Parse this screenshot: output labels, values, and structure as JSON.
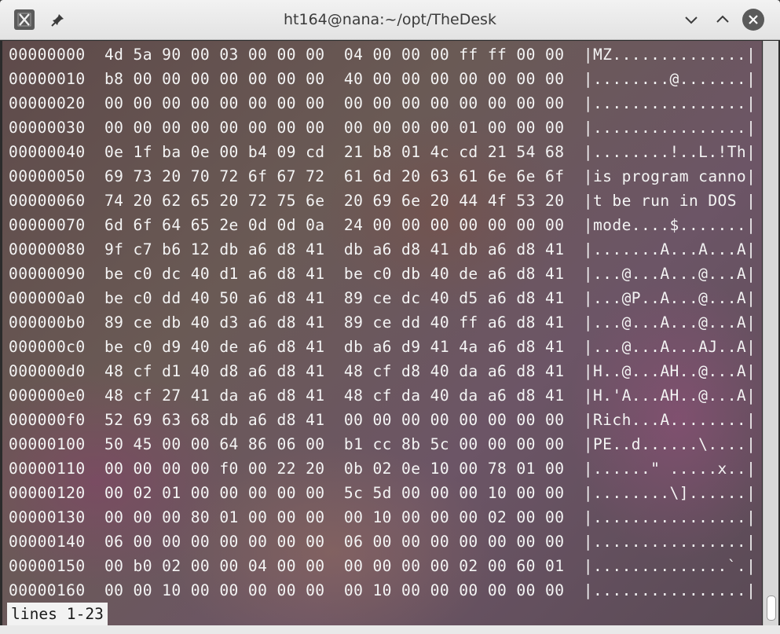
{
  "window": {
    "title": "ht164@nana:~/opt/TheDesk",
    "icons": {
      "app": "terminal-app-icon",
      "pin": "pin-icon",
      "minimize": "chevron-down-icon",
      "maximize": "chevron-up-icon",
      "close": "close-icon"
    }
  },
  "terminal": {
    "lines": [
      "00000000  4d 5a 90 00 03 00 00 00  04 00 00 00 ff ff 00 00  |MZ..............|",
      "00000010  b8 00 00 00 00 00 00 00  40 00 00 00 00 00 00 00  |........@.......|",
      "00000020  00 00 00 00 00 00 00 00  00 00 00 00 00 00 00 00  |................|",
      "00000030  00 00 00 00 00 00 00 00  00 00 00 00 01 00 00 00  |................|",
      "00000040  0e 1f ba 0e 00 b4 09 cd  21 b8 01 4c cd 21 54 68  |........!..L.!Th|",
      "00000050  69 73 20 70 72 6f 67 72  61 6d 20 63 61 6e 6e 6f  |is program canno|",
      "00000060  74 20 62 65 20 72 75 6e  20 69 6e 20 44 4f 53 20  |t be run in DOS |",
      "00000070  6d 6f 64 65 2e 0d 0d 0a  24 00 00 00 00 00 00 00  |mode....$.......|",
      "00000080  9f c7 b6 12 db a6 d8 41  db a6 d8 41 db a6 d8 41  |.......A...A...A|",
      "00000090  be c0 dc 40 d1 a6 d8 41  be c0 db 40 de a6 d8 41  |...@...A...@...A|",
      "000000a0  be c0 dd 40 50 a6 d8 41  89 ce dc 40 d5 a6 d8 41  |...@P..A...@...A|",
      "000000b0  89 ce db 40 d3 a6 d8 41  89 ce dd 40 ff a6 d8 41  |...@...A...@...A|",
      "000000c0  be c0 d9 40 de a6 d8 41  db a6 d9 41 4a a6 d8 41  |...@...A...AJ..A|",
      "000000d0  48 cf d1 40 d8 a6 d8 41  48 cf d8 40 da a6 d8 41  |H..@...AH..@...A|",
      "000000e0  48 cf 27 41 da a6 d8 41  48 cf da 40 da a6 d8 41  |H.'A...AH..@...A|",
      "000000f0  52 69 63 68 db a6 d8 41  00 00 00 00 00 00 00 00  |Rich...A........|",
      "00000100  50 45 00 00 64 86 06 00  b1 cc 8b 5c 00 00 00 00  |PE..d......\\....|",
      "00000110  00 00 00 00 f0 00 22 20  0b 02 0e 10 00 78 01 00  |......\" .....x..|",
      "00000120  00 02 01 00 00 00 00 00  5c 5d 00 00 00 10 00 00  |........\\]......|",
      "00000130  00 00 00 80 01 00 00 00  00 10 00 00 00 02 00 00  |................|",
      "00000140  06 00 00 00 00 00 00 00  06 00 00 00 00 00 00 00  |................|",
      "00000150  00 b0 02 00 00 04 00 00  00 00 00 00 02 00 60 01  |..............`.|",
      "00000160  00 00 10 00 00 00 00 00  00 10 00 00 00 00 00 00  |................|"
    ],
    "status": "lines 1-23"
  }
}
